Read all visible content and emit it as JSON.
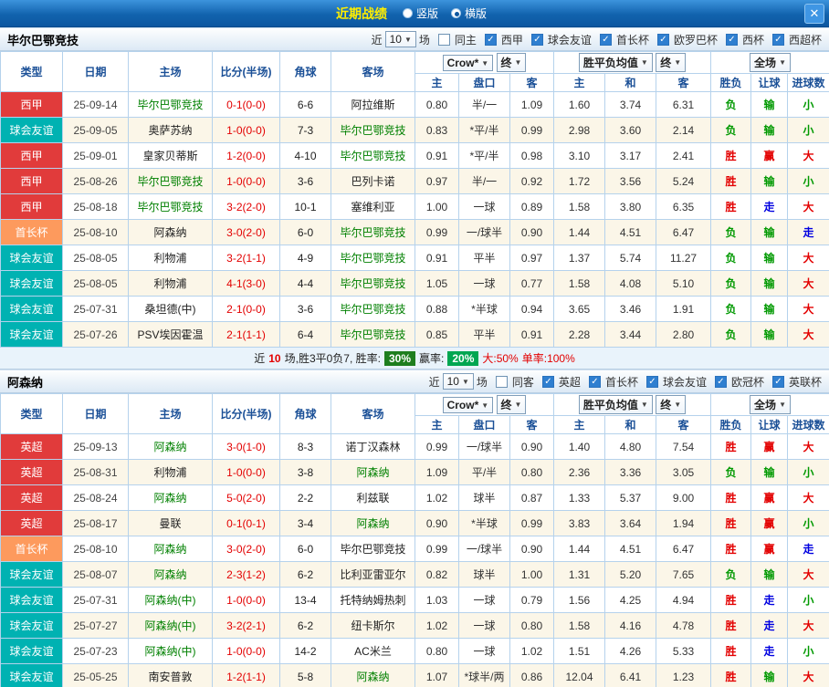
{
  "topbar": {
    "title": "近期战绩",
    "vertical_label": "竖版",
    "horizontal_label": "横版",
    "close_label": "✕"
  },
  "controls": {
    "recent": "近",
    "count": "10",
    "matches": "场",
    "company": "Crow*",
    "final": "终",
    "odds_avg": "胜平负均值",
    "scope": "全场"
  },
  "columns": {
    "type": "类型",
    "date": "日期",
    "home": "主场",
    "score": "比分(半场)",
    "corner": "角球",
    "away": "客场",
    "home_s": "主",
    "line": "盘口",
    "away_s": "客",
    "home_e": "主",
    "draw": "和",
    "away_e": "客",
    "wl": "胜负",
    "rq": "让球",
    "goals": "进球数"
  },
  "colors": {
    "league_red": "#e13b3b",
    "league_teal": "#00b2b2",
    "league_orange": "#fd9a5d",
    "win_red": "#e30000",
    "lose_green": "#009900",
    "push_blue": "#0000e0",
    "team_green": "#008000",
    "win_rate_badge_bg": "#1e7e1e",
    "profit_rate_badge_bg": "#00a651"
  },
  "sections": [
    {
      "team": "毕尔巴鄂竞技",
      "same_label": "同主",
      "leagues": [
        "西甲",
        "球会友谊",
        "首长杯",
        "欧罗巴杯",
        "西杯",
        "西超杯"
      ],
      "rows": [
        {
          "type": "西甲",
          "tc": "red",
          "date": "25-09-14",
          "home": "毕尔巴鄂竞技",
          "hg": true,
          "score": "0-1(0-0)",
          "corner": "6-6",
          "away": "阿拉维斯",
          "ag": false,
          "ah": [
            "0.80",
            "半/一",
            "1.09"
          ],
          "eu": [
            "1.60",
            "3.74",
            "6.31"
          ],
          "res": [
            "负",
            "输",
            "小"
          ],
          "rc": [
            "g",
            "g",
            "g"
          ]
        },
        {
          "type": "球会友谊",
          "tc": "teal",
          "date": "25-09-05",
          "home": "奥萨苏纳",
          "hg": false,
          "score": "1-0(0-0)",
          "corner": "7-3",
          "away": "毕尔巴鄂竞技",
          "ag": true,
          "ah": [
            "0.83",
            "*平/半",
            "0.99"
          ],
          "eu": [
            "2.98",
            "3.60",
            "2.14"
          ],
          "res": [
            "负",
            "输",
            "小"
          ],
          "rc": [
            "g",
            "g",
            "g"
          ]
        },
        {
          "type": "西甲",
          "tc": "red",
          "date": "25-09-01",
          "home": "皇家贝蒂斯",
          "hg": false,
          "score": "1-2(0-0)",
          "corner": "4-10",
          "away": "毕尔巴鄂竞技",
          "ag": true,
          "ah": [
            "0.91",
            "*平/半",
            "0.98"
          ],
          "eu": [
            "3.10",
            "3.17",
            "2.41"
          ],
          "res": [
            "胜",
            "赢",
            "大"
          ],
          "rc": [
            "r",
            "r",
            "r"
          ]
        },
        {
          "type": "西甲",
          "tc": "red",
          "date": "25-08-26",
          "home": "毕尔巴鄂竞技",
          "hg": true,
          "score": "1-0(0-0)",
          "corner": "3-6",
          "away": "巴列卡诺",
          "ag": false,
          "ah": [
            "0.97",
            "半/一",
            "0.92"
          ],
          "eu": [
            "1.72",
            "3.56",
            "5.24"
          ],
          "res": [
            "胜",
            "输",
            "小"
          ],
          "rc": [
            "r",
            "g",
            "g"
          ]
        },
        {
          "type": "西甲",
          "tc": "red",
          "date": "25-08-18",
          "home": "毕尔巴鄂竞技",
          "hg": true,
          "score": "3-2(2-0)",
          "corner": "10-1",
          "away": "塞维利亚",
          "ag": false,
          "ah": [
            "1.00",
            "一球",
            "0.89"
          ],
          "eu": [
            "1.58",
            "3.80",
            "6.35"
          ],
          "res": [
            "胜",
            "走",
            "大"
          ],
          "rc": [
            "r",
            "b",
            "r"
          ]
        },
        {
          "type": "首长杯",
          "tc": "org",
          "date": "25-08-10",
          "home": "阿森纳",
          "hg": false,
          "score": "3-0(2-0)",
          "corner": "6-0",
          "away": "毕尔巴鄂竞技",
          "ag": true,
          "ah": [
            "0.99",
            "一/球半",
            "0.90"
          ],
          "eu": [
            "1.44",
            "4.51",
            "6.47"
          ],
          "res": [
            "负",
            "输",
            "走"
          ],
          "rc": [
            "g",
            "g",
            "b"
          ]
        },
        {
          "type": "球会友谊",
          "tc": "teal",
          "date": "25-08-05",
          "home": "利物浦",
          "hg": false,
          "score": "3-2(1-1)",
          "corner": "4-9",
          "away": "毕尔巴鄂竞技",
          "ag": true,
          "ah": [
            "0.91",
            "平半",
            "0.97"
          ],
          "eu": [
            "1.37",
            "5.74",
            "11.27"
          ],
          "res": [
            "负",
            "输",
            "大"
          ],
          "rc": [
            "g",
            "g",
            "r"
          ]
        },
        {
          "type": "球会友谊",
          "tc": "teal",
          "date": "25-08-05",
          "home": "利物浦",
          "hg": false,
          "score": "4-1(3-0)",
          "corner": "4-4",
          "away": "毕尔巴鄂竞技",
          "ag": true,
          "ah": [
            "1.05",
            "一球",
            "0.77"
          ],
          "eu": [
            "1.58",
            "4.08",
            "5.10"
          ],
          "res": [
            "负",
            "输",
            "大"
          ],
          "rc": [
            "g",
            "g",
            "r"
          ]
        },
        {
          "type": "球会友谊",
          "tc": "teal",
          "date": "25-07-31",
          "home": "桑坦德(中)",
          "hg": false,
          "score": "2-1(0-0)",
          "corner": "3-6",
          "away": "毕尔巴鄂竞技",
          "ag": true,
          "ah": [
            "0.88",
            "*半球",
            "0.94"
          ],
          "eu": [
            "3.65",
            "3.46",
            "1.91"
          ],
          "res": [
            "负",
            "输",
            "大"
          ],
          "rc": [
            "g",
            "g",
            "r"
          ]
        },
        {
          "type": "球会友谊",
          "tc": "teal",
          "date": "25-07-26",
          "home": "PSV埃因霍温",
          "hg": false,
          "score": "2-1(1-1)",
          "corner": "6-4",
          "away": "毕尔巴鄂竞技",
          "ag": true,
          "ah": [
            "0.85",
            "平半",
            "0.91"
          ],
          "eu": [
            "2.28",
            "3.44",
            "2.80"
          ],
          "res": [
            "负",
            "输",
            "大"
          ],
          "rc": [
            "g",
            "g",
            "r"
          ]
        }
      ],
      "summary": {
        "prefix": "近",
        "count": "10",
        "mid": "场,胜3平0负7, 胜率:",
        "win_badge": "30%",
        "mid2": "赢率:",
        "profit_badge": "20%",
        "big": "大:50%",
        "single": "单率:100%"
      }
    },
    {
      "team": "阿森纳",
      "same_label": "同客",
      "leagues": [
        "英超",
        "首长杯",
        "球会友谊",
        "欧冠杯",
        "英联杯"
      ],
      "rows": [
        {
          "type": "英超",
          "tc": "red",
          "date": "25-09-13",
          "home": "阿森纳",
          "hg": true,
          "score": "3-0(1-0)",
          "corner": "8-3",
          "away": "诺丁汉森林",
          "ag": false,
          "ah": [
            "0.99",
            "一/球半",
            "0.90"
          ],
          "eu": [
            "1.40",
            "4.80",
            "7.54"
          ],
          "res": [
            "胜",
            "赢",
            "大"
          ],
          "rc": [
            "r",
            "r",
            "r"
          ]
        },
        {
          "type": "英超",
          "tc": "red",
          "date": "25-08-31",
          "home": "利物浦",
          "hg": false,
          "score": "1-0(0-0)",
          "corner": "3-8",
          "away": "阿森纳",
          "ag": true,
          "ah": [
            "1.09",
            "平/半",
            "0.80"
          ],
          "eu": [
            "2.36",
            "3.36",
            "3.05"
          ],
          "res": [
            "负",
            "输",
            "小"
          ],
          "rc": [
            "g",
            "g",
            "g"
          ]
        },
        {
          "type": "英超",
          "tc": "red",
          "date": "25-08-24",
          "home": "阿森纳",
          "hg": true,
          "score": "5-0(2-0)",
          "corner": "2-2",
          "away": "利兹联",
          "ag": false,
          "ah": [
            "1.02",
            "球半",
            "0.87"
          ],
          "eu": [
            "1.33",
            "5.37",
            "9.00"
          ],
          "res": [
            "胜",
            "赢",
            "大"
          ],
          "rc": [
            "r",
            "r",
            "r"
          ]
        },
        {
          "type": "英超",
          "tc": "red",
          "date": "25-08-17",
          "home": "曼联",
          "hg": false,
          "score": "0-1(0-1)",
          "corner": "3-4",
          "away": "阿森纳",
          "ag": true,
          "ah": [
            "0.90",
            "*半球",
            "0.99"
          ],
          "eu": [
            "3.83",
            "3.64",
            "1.94"
          ],
          "res": [
            "胜",
            "赢",
            "小"
          ],
          "rc": [
            "r",
            "r",
            "g"
          ]
        },
        {
          "type": "首长杯",
          "tc": "org",
          "date": "25-08-10",
          "home": "阿森纳",
          "hg": true,
          "score": "3-0(2-0)",
          "corner": "6-0",
          "away": "毕尔巴鄂竞技",
          "ag": false,
          "ah": [
            "0.99",
            "一/球半",
            "0.90"
          ],
          "eu": [
            "1.44",
            "4.51",
            "6.47"
          ],
          "res": [
            "胜",
            "赢",
            "走"
          ],
          "rc": [
            "r",
            "r",
            "b"
          ]
        },
        {
          "type": "球会友谊",
          "tc": "teal",
          "date": "25-08-07",
          "home": "阿森纳",
          "hg": true,
          "score": "2-3(1-2)",
          "corner": "6-2",
          "away": "比利亚雷亚尔",
          "ag": false,
          "ah": [
            "0.82",
            "球半",
            "1.00"
          ],
          "eu": [
            "1.31",
            "5.20",
            "7.65"
          ],
          "res": [
            "负",
            "输",
            "大"
          ],
          "rc": [
            "g",
            "g",
            "r"
          ]
        },
        {
          "type": "球会友谊",
          "tc": "teal",
          "date": "25-07-31",
          "home": "阿森纳(中)",
          "hg": true,
          "score": "1-0(0-0)",
          "corner": "13-4",
          "away": "托特纳姆热刺",
          "ag": false,
          "ah": [
            "1.03",
            "一球",
            "0.79"
          ],
          "eu": [
            "1.56",
            "4.25",
            "4.94"
          ],
          "res": [
            "胜",
            "走",
            "小"
          ],
          "rc": [
            "r",
            "b",
            "g"
          ]
        },
        {
          "type": "球会友谊",
          "tc": "teal",
          "date": "25-07-27",
          "home": "阿森纳(中)",
          "hg": true,
          "score": "3-2(2-1)",
          "corner": "6-2",
          "away": "纽卡斯尔",
          "ag": false,
          "ah": [
            "1.02",
            "一球",
            "0.80"
          ],
          "eu": [
            "1.58",
            "4.16",
            "4.78"
          ],
          "res": [
            "胜",
            "走",
            "大"
          ],
          "rc": [
            "r",
            "b",
            "r"
          ]
        },
        {
          "type": "球会友谊",
          "tc": "teal",
          "date": "25-07-23",
          "home": "阿森纳(中)",
          "hg": true,
          "score": "1-0(0-0)",
          "corner": "14-2",
          "away": "AC米兰",
          "ag": false,
          "ah": [
            "0.80",
            "一球",
            "1.02"
          ],
          "eu": [
            "1.51",
            "4.26",
            "5.33"
          ],
          "res": [
            "胜",
            "走",
            "小"
          ],
          "rc": [
            "r",
            "b",
            "g"
          ]
        },
        {
          "type": "球会友谊",
          "tc": "teal",
          "date": "25-05-25",
          "home": "南安普敦",
          "hg": false,
          "score": "1-2(1-1)",
          "corner": "5-8",
          "away": "阿森纳",
          "ag": true,
          "ah": [
            "1.07",
            "*球半/两",
            "0.86"
          ],
          "eu": [
            "12.04",
            "6.41",
            "1.23"
          ],
          "res": [
            "胜",
            "输",
            "大"
          ],
          "rc": [
            "r",
            "g",
            "r"
          ]
        }
      ]
    }
  ]
}
